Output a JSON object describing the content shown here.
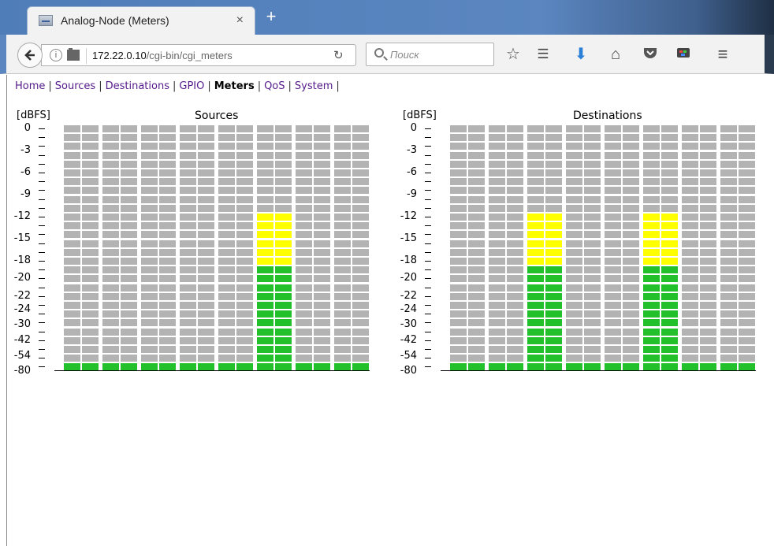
{
  "browser": {
    "tab_title": "Analog-Node (Meters)",
    "tab_close": "×",
    "new_tab": "+",
    "url_host": "172.22.0.10",
    "url_path": "/cgi-bin/cgi_meters",
    "search_placeholder": "Поиск"
  },
  "nav": {
    "items": [
      "Home",
      "Sources",
      "Destinations",
      "GPIO",
      "Meters",
      "QoS",
      "System"
    ],
    "current": "Meters",
    "separator": "|"
  },
  "meters": {
    "unit": "[dBFS]",
    "scale_labels": [
      "0",
      "-3",
      "-6",
      "-9",
      "-12",
      "-15",
      "-18",
      "-20",
      "-22",
      "-24",
      "-30",
      "-42",
      "-54",
      "-80"
    ],
    "segments_per_meter": 28,
    "panels": [
      {
        "title": "Sources",
        "levels": [
          1,
          1,
          1,
          1,
          1,
          1,
          1,
          1,
          1,
          1,
          18,
          18,
          1,
          1,
          1,
          1
        ]
      },
      {
        "title": "Destinations",
        "levels": [
          1,
          1,
          1,
          1,
          18,
          18,
          1,
          1,
          1,
          1,
          18,
          18,
          1,
          1,
          1,
          1
        ]
      }
    ],
    "colors": {
      "off": "#b3b3b3",
      "green": "#22c02a",
      "yellow": "#ffff00"
    }
  }
}
